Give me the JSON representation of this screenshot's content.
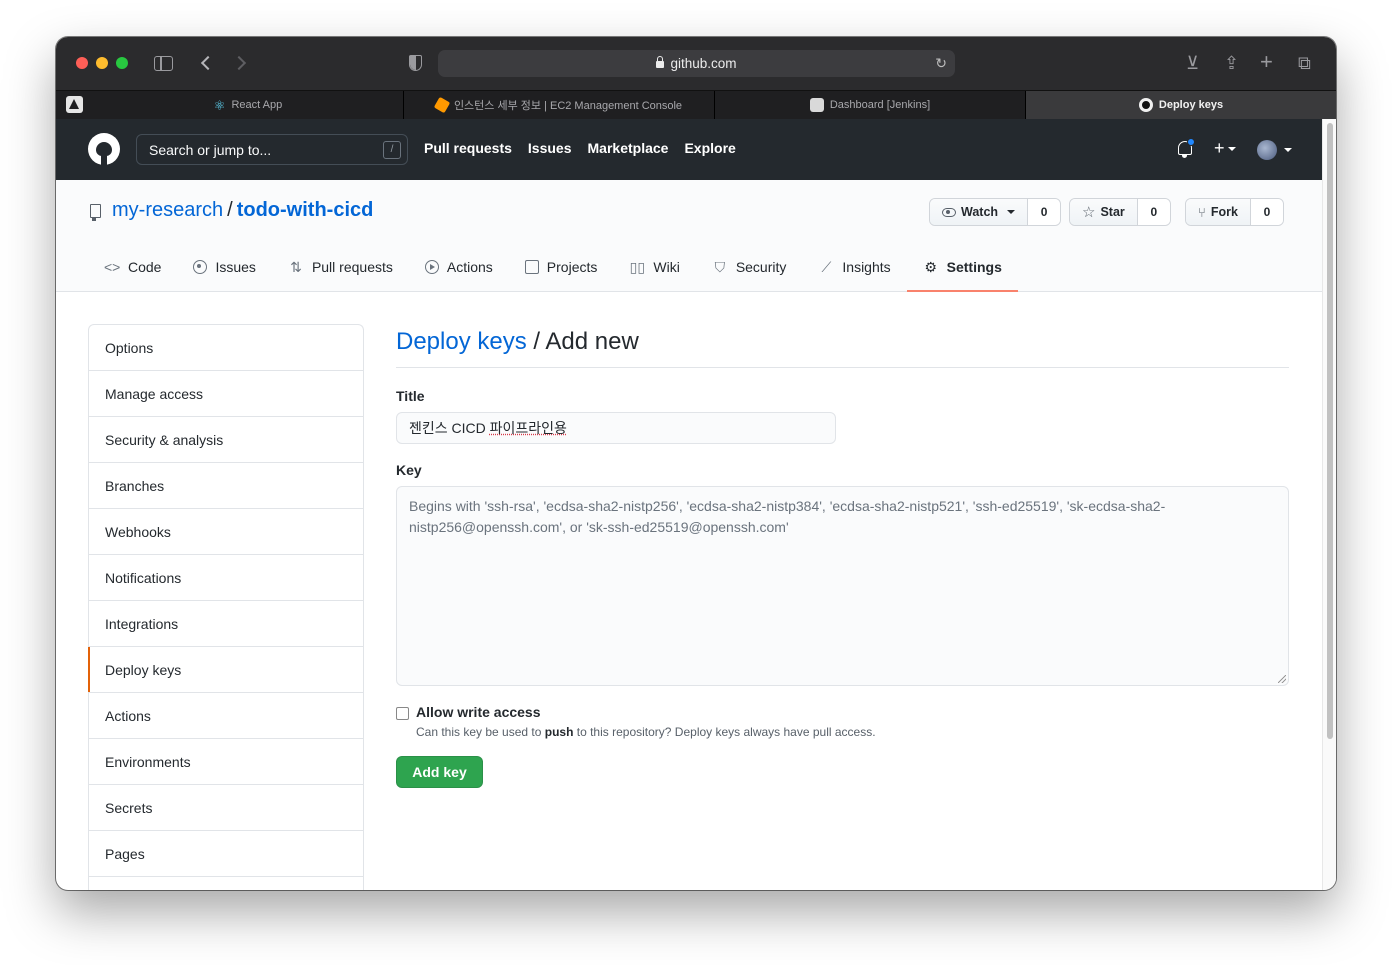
{
  "browser": {
    "url": "github.com",
    "tabs": [
      {
        "label": "React App",
        "icon": "react-icon",
        "active": false
      },
      {
        "label": "인스턴스 세부 정보 | EC2 Management Console",
        "icon": "aws-icon",
        "active": false
      },
      {
        "label": "Dashboard [Jenkins]",
        "icon": "jenkins-icon",
        "active": false
      },
      {
        "label": "Deploy keys",
        "icon": "github-icon",
        "active": true
      }
    ]
  },
  "header": {
    "search_placeholder": "Search or jump to...",
    "slash_key": "/",
    "nav": [
      "Pull requests",
      "Issues",
      "Marketplace",
      "Explore"
    ],
    "plus": "+"
  },
  "repo": {
    "owner": "my-research",
    "separator": "/",
    "name": "todo-with-cicd",
    "watch_label": "Watch",
    "watch_count": "0",
    "star_label": "Star",
    "star_count": "0",
    "fork_label": "Fork",
    "fork_count": "0",
    "tabs": [
      {
        "label": "Code",
        "icon": "code-icon"
      },
      {
        "label": "Issues",
        "icon": "issue-icon"
      },
      {
        "label": "Pull requests",
        "icon": "pull-request-icon"
      },
      {
        "label": "Actions",
        "icon": "play-icon"
      },
      {
        "label": "Projects",
        "icon": "project-icon"
      },
      {
        "label": "Wiki",
        "icon": "book-icon"
      },
      {
        "label": "Security",
        "icon": "shield-icon"
      },
      {
        "label": "Insights",
        "icon": "graph-icon"
      },
      {
        "label": "Settings",
        "icon": "gear-icon",
        "selected": true
      }
    ]
  },
  "settings_menu": [
    "Options",
    "Manage access",
    "Security & analysis",
    "Branches",
    "Webhooks",
    "Notifications",
    "Integrations",
    "Deploy keys",
    "Actions",
    "Environments",
    "Secrets",
    "Pages"
  ],
  "settings_menu_selected": "Deploy keys",
  "form": {
    "breadcrumb_link": "Deploy keys",
    "breadcrumb_sep": " / ",
    "breadcrumb_current": "Add new",
    "title_label": "Title",
    "title_value_prefix": "젠킨스 CICD ",
    "title_value_misspelled": "파이프라인용",
    "key_label": "Key",
    "key_placeholder": "Begins with 'ssh-rsa', 'ecdsa-sha2-nistp256', 'ecdsa-sha2-nistp384', 'ecdsa-sha2-nistp521', 'ssh-ed25519', 'sk-ecdsa-sha2-nistp256@openssh.com', or 'sk-ssh-ed25519@openssh.com'",
    "write_access_label": "Allow write access",
    "write_access_checked": false,
    "write_access_note_before": "Can this key be used to ",
    "write_access_note_bold": "push",
    "write_access_note_after": " to this repository? Deploy keys always have pull access.",
    "submit_label": "Add key"
  },
  "colors": {
    "github_header": "#24292e",
    "link": "#0366d6",
    "selected_underline": "#f9826c",
    "primary_button": "#2ea44f"
  }
}
